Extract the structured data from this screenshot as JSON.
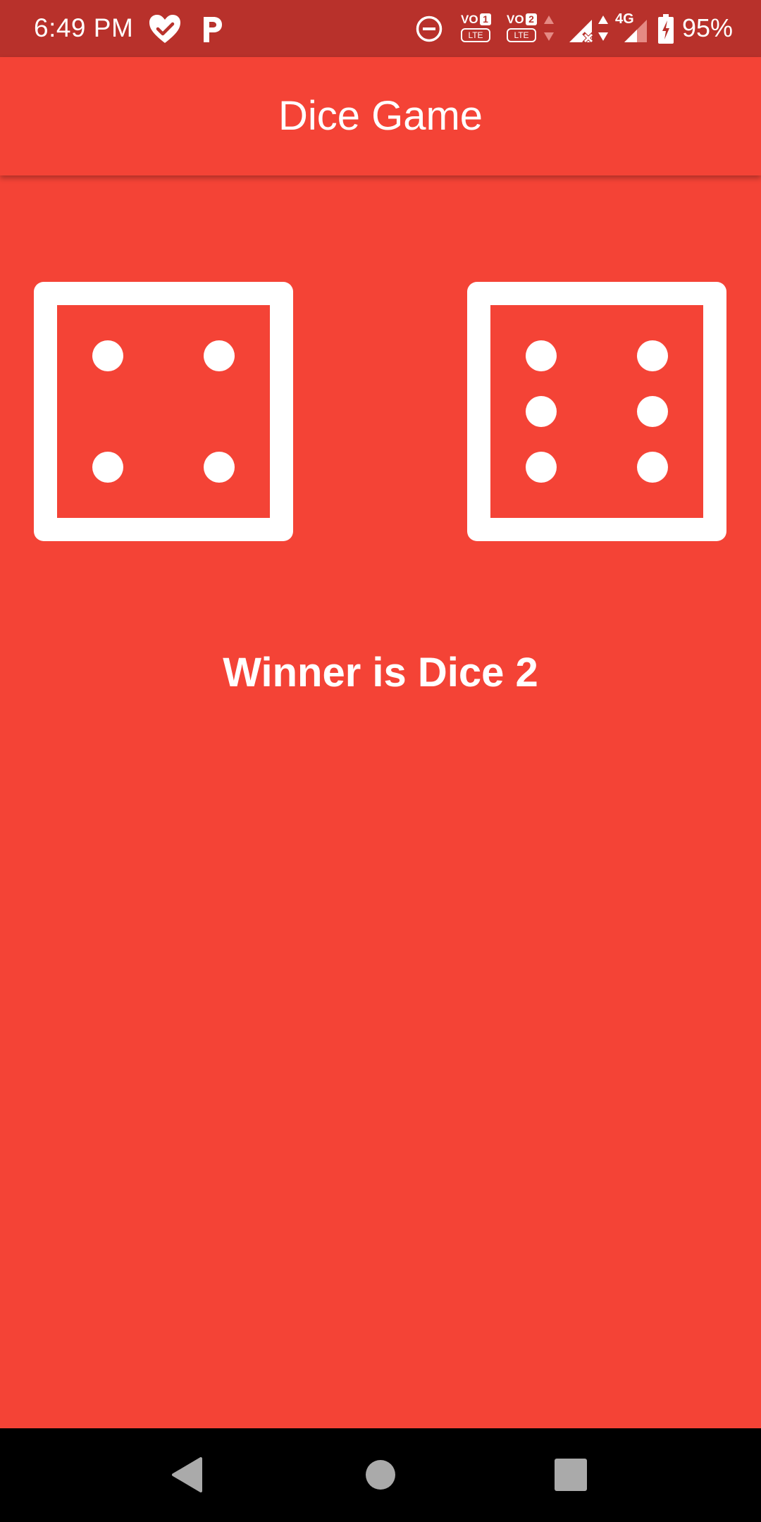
{
  "status_bar": {
    "time": "6:49 PM",
    "battery_percent": "95%",
    "sim1_label": "VO",
    "sim1_number": "1",
    "sim2_label": "VO",
    "sim2_number": "2",
    "lte_label": "LTE",
    "network_type": "4G",
    "icons": [
      "heart-check-icon",
      "p-app-icon",
      "do-not-disturb-icon",
      "volte-1-icon",
      "volte-2-icon",
      "signal-no-service-icon",
      "signal-4g-icon",
      "battery-charging-icon"
    ]
  },
  "app_bar": {
    "title": "Dice Game"
  },
  "game": {
    "dice_1_value": 4,
    "dice_2_value": 6,
    "result_text": "Winner is Dice 2"
  },
  "nav_bar": {
    "icons": [
      "back-icon",
      "home-icon",
      "recents-icon"
    ]
  },
  "colors": {
    "background": "#f44336",
    "status_bar": "#b8312b",
    "foreground": "#ffffff",
    "nav_bar": "#000000"
  }
}
